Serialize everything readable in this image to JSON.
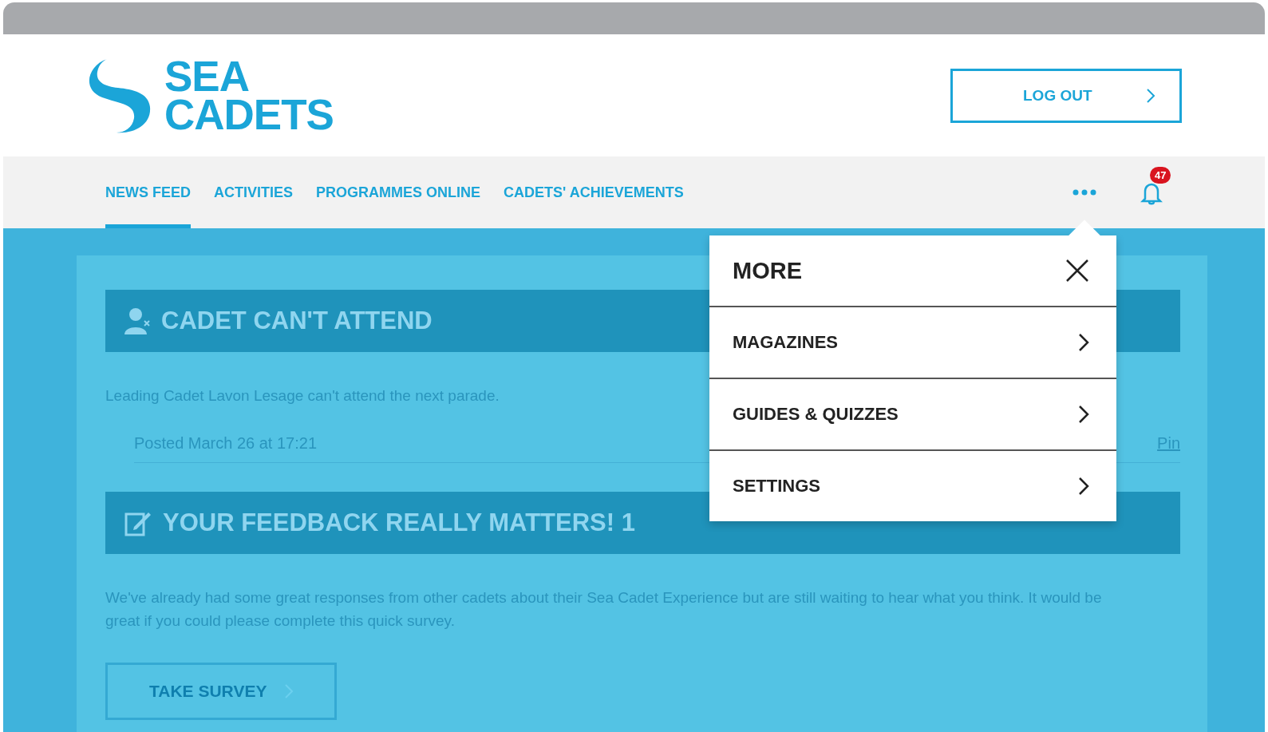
{
  "header": {
    "logo": [
      "SEA",
      "CADETS"
    ],
    "logout_button": "LOG OUT"
  },
  "nav": {
    "items": [
      {
        "label": "NEWS FEED",
        "selected": true
      },
      {
        "label": "ACTIVITIES",
        "selected": false
      },
      {
        "label": "PROGRAMMES ONLINE",
        "selected": false
      },
      {
        "label": "CADETS' ACHIEVEMENTS",
        "selected": false
      }
    ],
    "notification_count": "47"
  },
  "feed": [
    {
      "kind": "cant-attend",
      "title": "CADET CAN'T ATTEND",
      "body": "Leading Cadet Lavon Lesage can't attend the next parade.",
      "posted": "Posted March 26 at 17:21",
      "link": "Pin"
    },
    {
      "kind": "feedback",
      "title": "YOUR FEEDBACK REALLY MATTERS! 1",
      "body": "We've already had some great responses from other cadets about their Sea Cadet Experience but are still waiting to hear what you think. It would be great if you could please complete this quick survey.",
      "button": "TAKE SURVEY"
    }
  ],
  "more_menu": {
    "title": "MORE",
    "items": [
      "MAGAZINES",
      "GUIDES & QUIZZES",
      "SETTINGS"
    ]
  }
}
